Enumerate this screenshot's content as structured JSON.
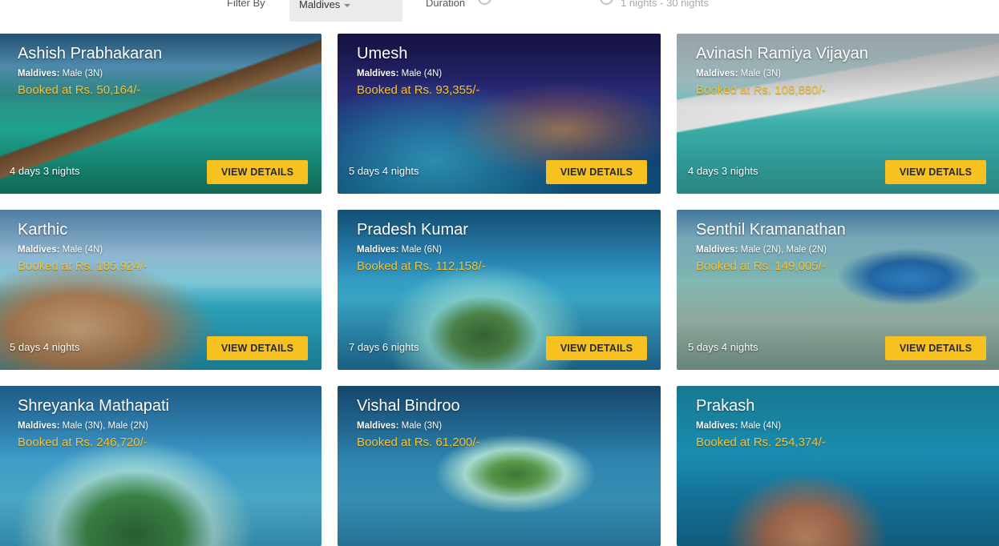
{
  "filter": {
    "label": "Filter By",
    "destination": "Maldives",
    "duration_label": "Duration",
    "duration_range": "1 nights - 30 nights"
  },
  "colors": {
    "accent": "#f7c21f",
    "price": "#f7c234",
    "slider": "#f7b733"
  },
  "cards": [
    {
      "name": "Ashish Prabhakaran",
      "dest": "Maldives:",
      "stay": "Male (3N)",
      "price": "Booked at Rs. 50,164/-",
      "duration": "4 days 3 nights",
      "cta": "VIEW DETAILS"
    },
    {
      "name": "Umesh",
      "dest": "Maldives:",
      "stay": "Male (4N)",
      "price": "Booked at Rs. 93,355/-",
      "duration": "5 days 4 nights",
      "cta": "VIEW DETAILS"
    },
    {
      "name": "Avinash Ramiya Vijayan",
      "dest": "Maldives:",
      "stay": "Male (3N)",
      "price": "Booked at Rs. 108,880/-",
      "duration": "4 days 3 nights",
      "cta": "VIEW DETAILS"
    },
    {
      "name": "Karthic",
      "dest": "Maldives:",
      "stay": "Male (4N)",
      "price": "Booked at Rs. 185,924/-",
      "duration": "5 days 4 nights",
      "cta": "VIEW DETAILS"
    },
    {
      "name": "Pradesh Kumar",
      "dest": "Maldives:",
      "stay": "Male (6N)",
      "price": "Booked at Rs. 112,158/-",
      "duration": "7 days 6 nights",
      "cta": "VIEW DETAILS"
    },
    {
      "name": "Senthil Kramanathan",
      "dest": "Maldives:",
      "stay": "Male (2N), Male (2N)",
      "price": "Booked at Rs. 149,005/-",
      "duration": "5 days 4 nights",
      "cta": "VIEW DETAILS"
    },
    {
      "name": "Shreyanka Mathapati",
      "dest": "Maldives:",
      "stay": "Male (3N), Male (2N)",
      "price": "Booked at Rs. 246,720/-"
    },
    {
      "name": "Vishal Bindroo",
      "dest": "Maldives:",
      "stay": "Male (3N)",
      "price": "Booked at Rs. 61,200/-"
    },
    {
      "name": "Prakash",
      "dest": "Maldives:",
      "stay": "Male (4N)",
      "price": "Booked at Rs. 254,374/-"
    }
  ]
}
